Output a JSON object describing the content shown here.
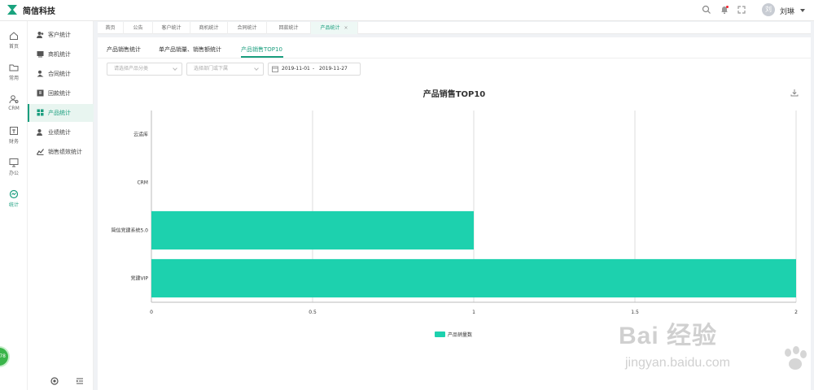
{
  "app": {
    "title": "简信科技",
    "user_name": "刘琳",
    "avatar_text": "刘"
  },
  "rail": [
    {
      "label": "首页",
      "icon": "home-icon"
    },
    {
      "label": "常用",
      "icon": "folder-icon"
    },
    {
      "label": "CRM",
      "icon": "crm-users-icon"
    },
    {
      "label": "财务",
      "icon": "finance-icon"
    },
    {
      "label": "办公",
      "icon": "monitor-icon"
    },
    {
      "label": "统计",
      "icon": "stats-icon",
      "active": true
    }
  ],
  "fab_text": "78",
  "subnav": [
    {
      "label": "客户统计",
      "icon": "customer-icon"
    },
    {
      "label": "商机统计",
      "icon": "opportunity-icon"
    },
    {
      "label": "合同统计",
      "icon": "contract-icon"
    },
    {
      "label": "回款统计",
      "icon": "payment-icon"
    },
    {
      "label": "产品统计",
      "icon": "product-icon",
      "active": true
    },
    {
      "label": "业绩统计",
      "icon": "performance-icon"
    },
    {
      "label": "销售绩效统计",
      "icon": "sales-kpi-icon"
    }
  ],
  "page_tabs": [
    {
      "label": "首页"
    },
    {
      "label": "公告"
    },
    {
      "label": "客户统计"
    },
    {
      "label": "商机统计"
    },
    {
      "label": "合同统计"
    },
    {
      "label": "回款统计"
    },
    {
      "label": "产品统计",
      "active": true,
      "close": "×"
    }
  ],
  "sub_tabs": [
    "产品销售统计",
    "单产品销量、销售额统计",
    "产品销售TOP10"
  ],
  "filters": {
    "category_placeholder": "请选择产品分类",
    "department_placeholder": "选择部门或下属",
    "date_start": "2019-11-01",
    "date_sep": "-",
    "date_end": "2019-11-27"
  },
  "chart_data": {
    "type": "bar",
    "orientation": "horizontal",
    "title": "产品销售TOP10",
    "categories": [
      "云适库",
      "CRM",
      "简信党建系统5.0",
      "党建VIP"
    ],
    "series": [
      {
        "name": "产品销量数",
        "values": [
          0,
          0,
          1,
          2
        ],
        "color": "#1dd1ae"
      }
    ],
    "xlim": [
      0,
      2
    ],
    "xticks": [
      "0",
      "0.5",
      "1",
      "1.5",
      "2"
    ],
    "grid": true,
    "legend_position": "bottom"
  },
  "colors": {
    "accent": "#1a9e7e",
    "bar": "#1dd1ae"
  },
  "watermark": {
    "main": "Bai 经验",
    "sub": "jingyan.baidu.com"
  }
}
